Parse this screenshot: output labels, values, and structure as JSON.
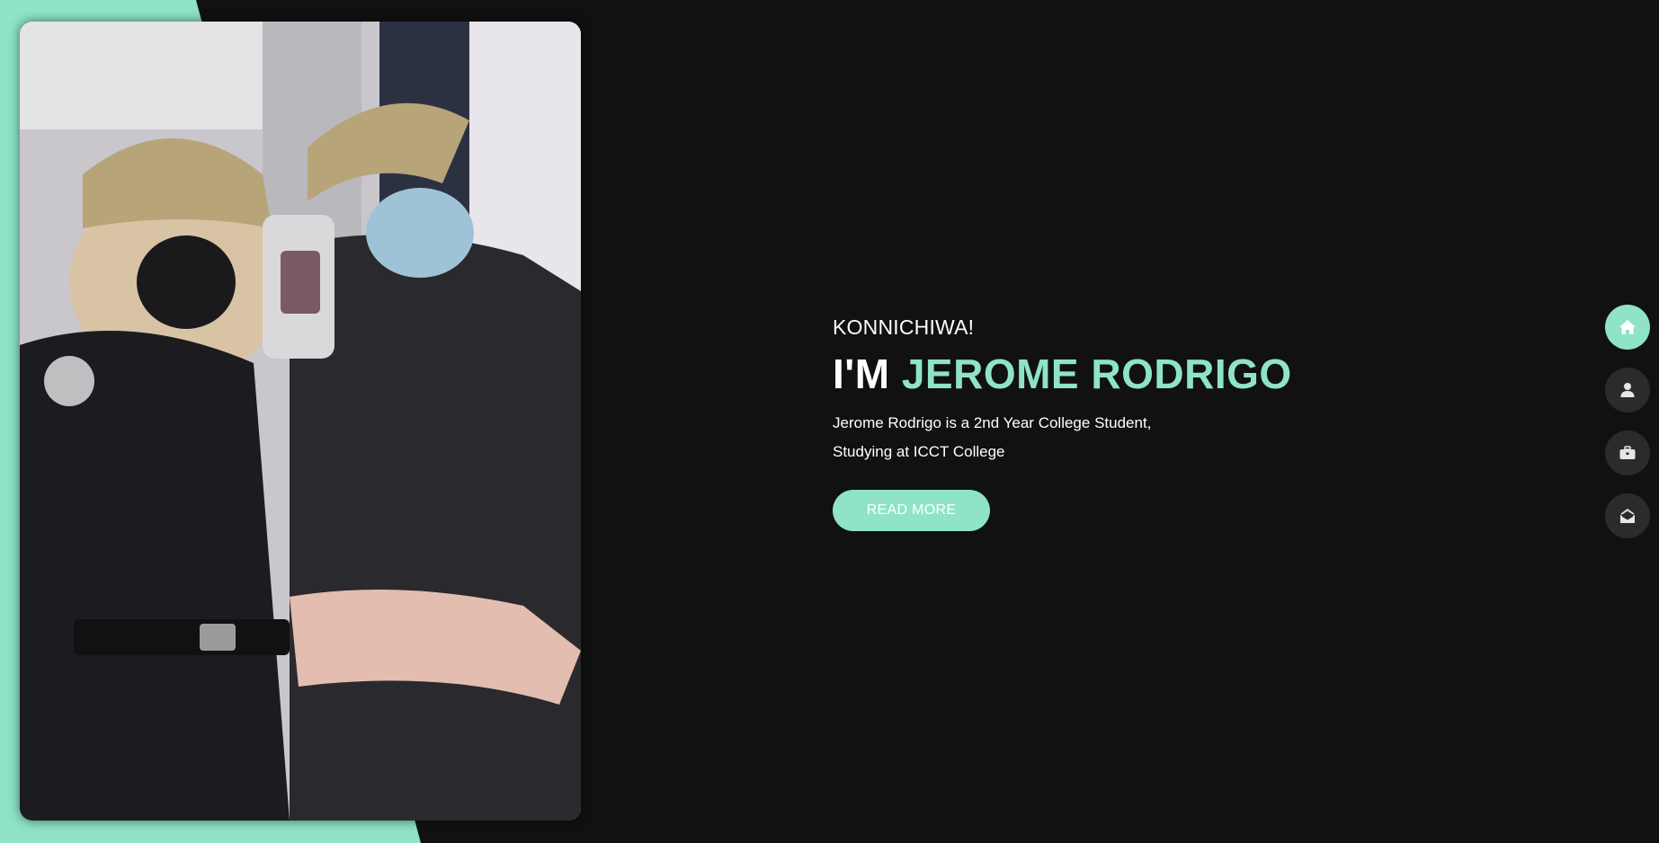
{
  "colors": {
    "accent": "#8ee4c5",
    "background": "#111111",
    "nav_inactive": "#2b2b2b"
  },
  "hero": {
    "greeting": "KONNICHIWA!",
    "heading_prefix": "I'M ",
    "heading_name": "JEROME RODRIGO",
    "description_line1": "Jerome Rodrigo is a 2nd Year College Student,",
    "description_line2": "Studying at ICCT College",
    "read_more_label": "READ MORE"
  },
  "nav": {
    "items": [
      {
        "icon": "home-icon",
        "active": true
      },
      {
        "icon": "user-icon",
        "active": false
      },
      {
        "icon": "briefcase-icon",
        "active": false
      },
      {
        "icon": "envelope-open-icon",
        "active": false
      }
    ]
  }
}
